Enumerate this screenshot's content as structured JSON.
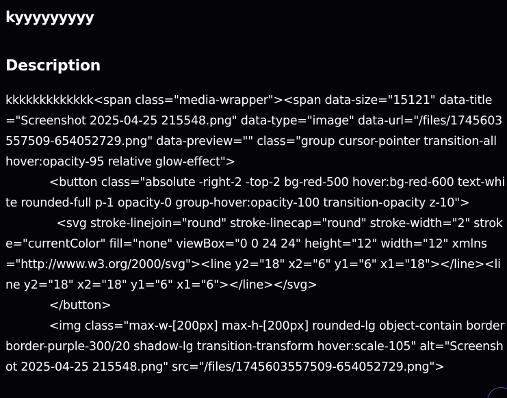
{
  "page": {
    "title": "kyyyyyyyyy"
  },
  "description": {
    "heading": "Description",
    "body": "kkkkkkkkkkkkk<span class=\"media-wrapper\"><span data-size=\"15121\" data-title=\"Screenshot 2025-04-25 215548.png\" data-type=\"image\" data-url=\"/files/1745603557509-654052729.png\" data-preview=\"\" class=\"group cursor-pointer transition-all hover:opacity-95 relative glow-effect\">\n            <button class=\"absolute -right-2 -top-2 bg-red-500 hover:bg-red-600 text-white rounded-full p-1 opacity-0 group-hover:opacity-100 transition-opacity z-10\">\n              <svg stroke-linejoin=\"round\" stroke-linecap=\"round\" stroke-width=\"2\" stroke=\"currentColor\" fill=\"none\" viewBox=\"0 0 24 24\" height=\"12\" width=\"12\" xmlns=\"http://www.w3.org/2000/svg\"><line y2=\"18\" x2=\"6\" y1=\"6\" x1=\"18\"></line><line y2=\"18\" x2=\"18\" y1=\"6\" x1=\"6\"></line></svg>\n            </button>\n            <img class=\"max-w-[200px] max-h-[200px] rounded-lg object-contain border border-purple-300/20 shadow-lg transition-transform hover:scale-105\" alt=\"Screenshot 2025-04-25 215548.png\" src=\"/files/1745603557509-654052729.png\">"
  },
  "colors": {
    "background": "#030308",
    "text": "#ffffff",
    "accent": "#6b3fa0"
  }
}
